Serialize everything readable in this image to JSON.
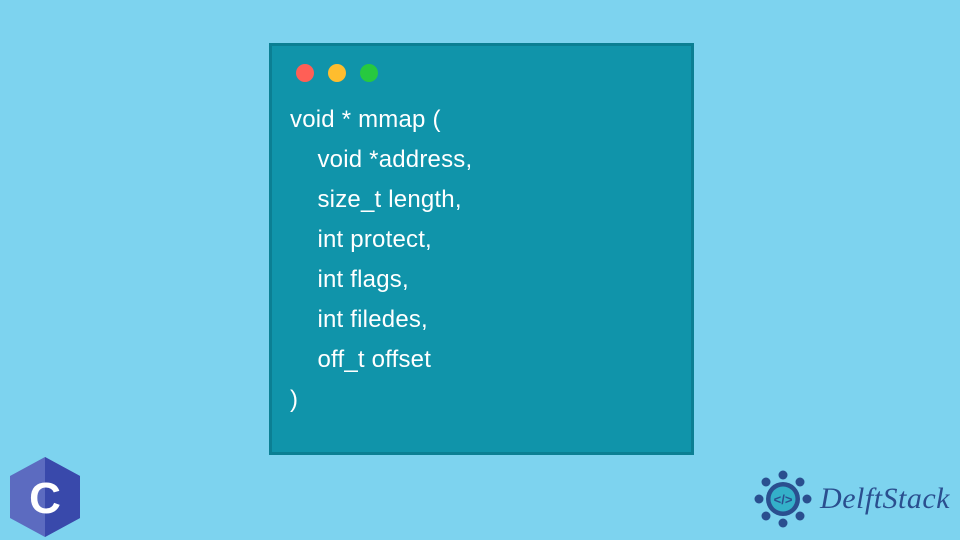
{
  "window": {
    "dots": [
      "red",
      "yellow",
      "green"
    ]
  },
  "code": {
    "line1": "void * mmap (",
    "line2": "    void *address,",
    "line3": "    size_t length,",
    "line4": "    int protect,",
    "line5": "    int flags,",
    "line6": "    int filedes,",
    "line7": "    off_t offset",
    "line8": ")"
  },
  "badge": {
    "letter": "C"
  },
  "brand": {
    "name": "DelftStack"
  },
  "colors": {
    "bg": "#7dd3ef",
    "window": "#1094aa",
    "brand": "#2a4f8f"
  }
}
